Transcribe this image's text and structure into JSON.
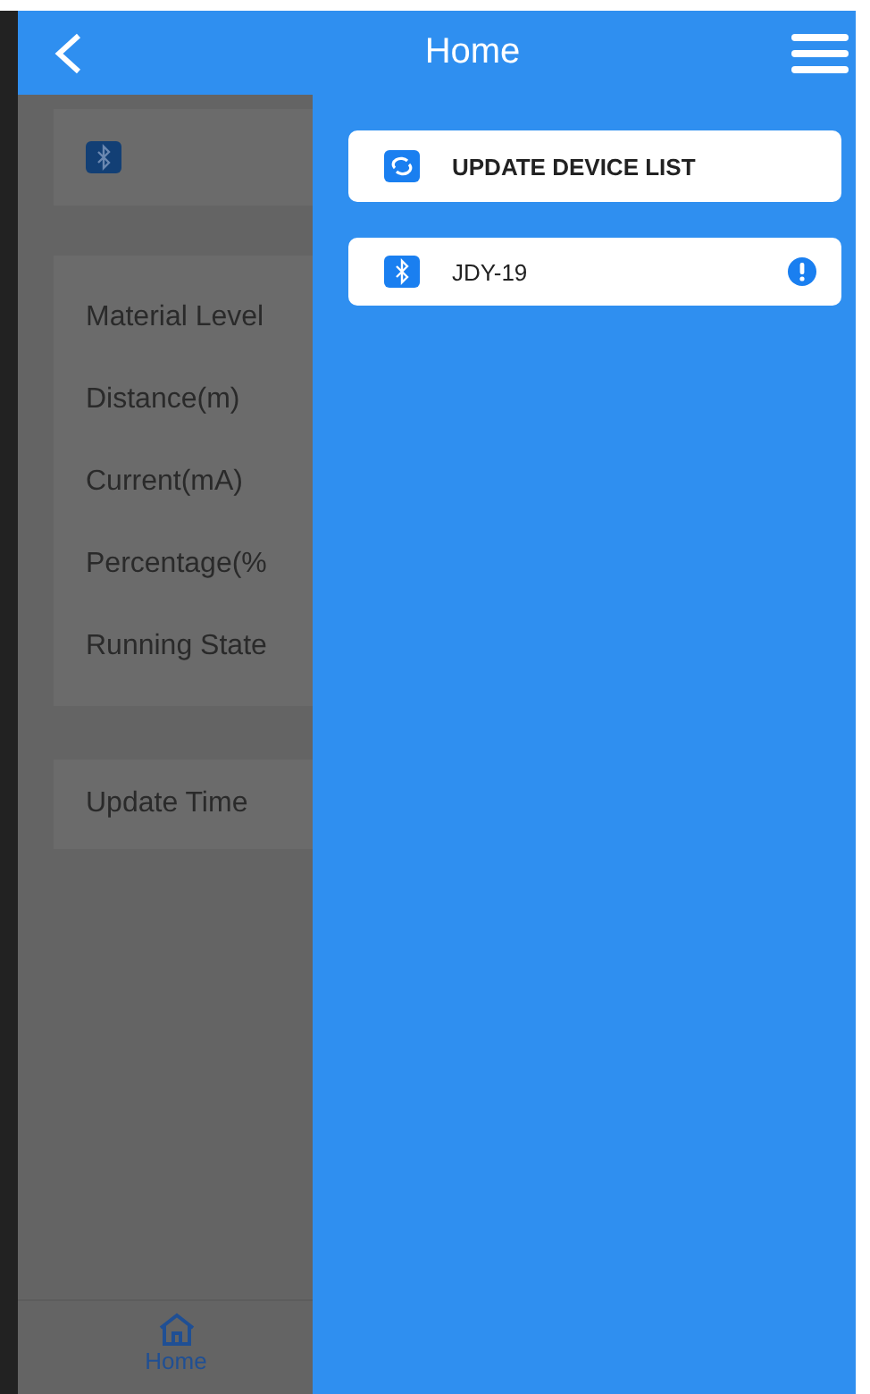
{
  "header": {
    "title": "Home"
  },
  "background_page": {
    "fields": [
      {
        "label": "Material Level"
      },
      {
        "label": "Distance(m)"
      },
      {
        "label": "Current(mA)"
      },
      {
        "label": "Percentage(%"
      },
      {
        "label": "Running State"
      }
    ],
    "update_label": "Update Time",
    "bottom_nav": [
      {
        "label": "Home",
        "selected": true
      }
    ]
  },
  "drawer": {
    "update_button": "UPDATE DEVICE LIST",
    "devices": [
      {
        "name": "JDY-19",
        "warning": true
      }
    ]
  }
}
